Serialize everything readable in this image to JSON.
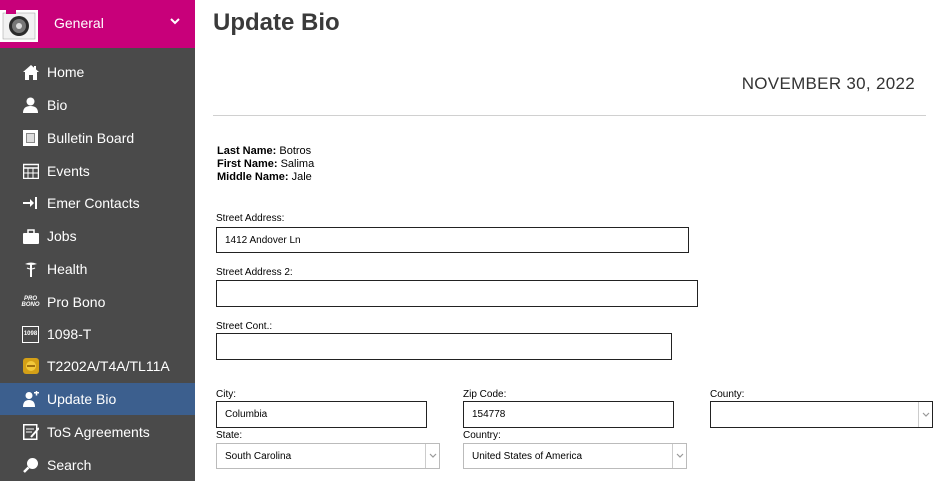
{
  "sidebar": {
    "title": "General",
    "items": [
      {
        "label": "Home",
        "icon": "home-icon"
      },
      {
        "label": "Bio",
        "icon": "person-icon"
      },
      {
        "label": "Bulletin Board",
        "icon": "bulletin-icon"
      },
      {
        "label": "Events",
        "icon": "calendar-icon"
      },
      {
        "label": "Emer Contacts",
        "icon": "contact-icon"
      },
      {
        "label": "Jobs",
        "icon": "briefcase-icon"
      },
      {
        "label": "Health",
        "icon": "caduceus-icon"
      },
      {
        "label": "Pro Bono",
        "icon": "pro-bono-icon"
      },
      {
        "label": "1098-T",
        "icon": "tax-form-icon"
      },
      {
        "label": "T2202A/T4A/TL11A",
        "icon": "canada-tax-icon"
      },
      {
        "label": "Update Bio",
        "icon": "update-person-icon",
        "active": true
      },
      {
        "label": "ToS Agreements",
        "icon": "agreement-icon"
      },
      {
        "label": "Search",
        "icon": "search-icon"
      }
    ],
    "pro_bono_icon_text": [
      "PRO",
      "BONO"
    ],
    "tax_icon_text": "1098"
  },
  "main": {
    "title": "Update Bio",
    "date": "NOVEMBER 30, 2022",
    "name": {
      "last_label": "Last Name:",
      "last": "Botros",
      "first_label": "First Name:",
      "first": "Salima",
      "middle_label": "Middle Name:",
      "middle": "Jale"
    },
    "form": {
      "street_label": "Street Address:",
      "street_value": "1412 Andover Ln",
      "street2_label": "Street Address 2:",
      "street2_value": "",
      "street_cont_label": "Street Cont.:",
      "street_cont_value": "",
      "city_label": "City:",
      "city_value": "Columbia",
      "zip_label": "Zip Code:",
      "zip_value": "154778",
      "county_label": "County:",
      "county_value": "",
      "state_label": "State:",
      "state_value": "South Carolina",
      "country_label": "Country:",
      "country_value": "United States of America"
    }
  },
  "colors": {
    "sidebar_bg": "#4a4a4a",
    "header_bg": "#c8007a",
    "active_bg": "#3c5f8e"
  }
}
